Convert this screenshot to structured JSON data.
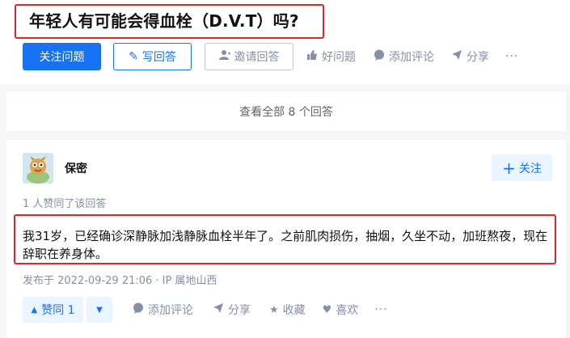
{
  "question": {
    "title": "年轻人有可能会得血栓（D.V.T）吗?",
    "actions": {
      "follow_question": "关注问题",
      "write_answer": "写回答",
      "invite_answer": "邀请回答",
      "good_question": "好问题",
      "add_comment": "添加评论",
      "share": "分享",
      "more": "···"
    }
  },
  "view_all": "查看全部 8 个回答",
  "answer": {
    "author": "保密",
    "follow_label": "关注",
    "voters": "1 人赞同了该回答",
    "content": "我31岁，已经确诊深静脉加浅静脉血栓半年了。之前肌肉损伤，抽烟，久坐不动，加班熬夜，现在辞职在养身体。",
    "meta": "发布于 2022-09-29 21:06 · IP 属地山西",
    "actions": {
      "upvote": "赞同 1",
      "add_comment": "添加评论",
      "share": "分享",
      "collect": "收藏",
      "like": "喜欢",
      "more": "···"
    }
  },
  "colors": {
    "accent": "#1772f6",
    "highlight_border": "#e0262b",
    "muted": "#8590a6"
  }
}
